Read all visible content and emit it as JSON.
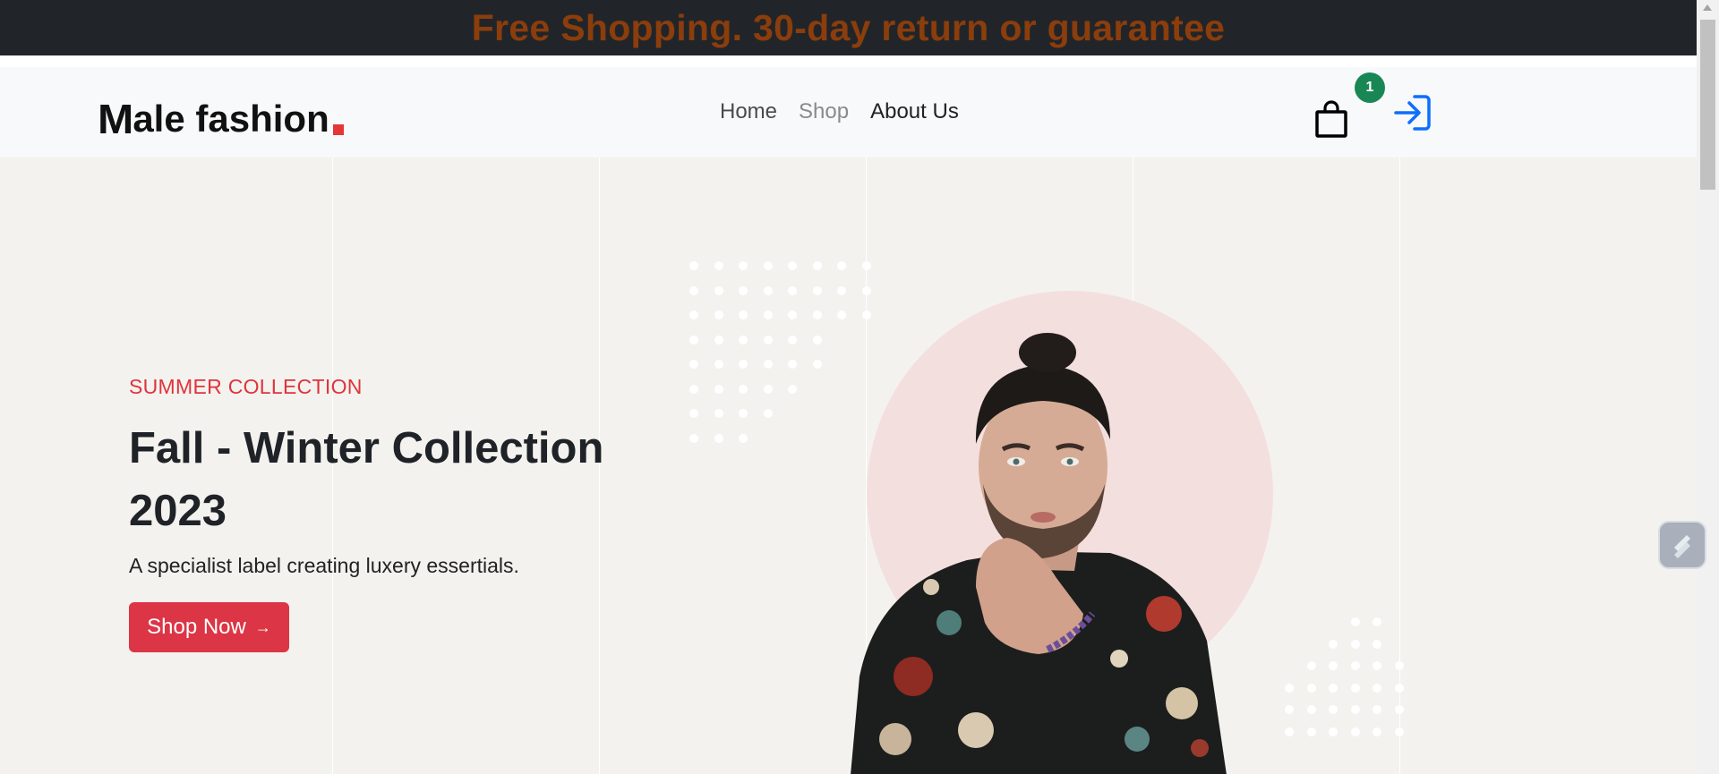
{
  "promo": {
    "text": "Free Shopping. 30-day return or guarantee"
  },
  "navbar": {
    "logo": {
      "first_letter": "M",
      "rest": "ale fashion",
      "accent_color": "#e53637"
    },
    "links": [
      {
        "label": "Home"
      },
      {
        "label": "Shop"
      },
      {
        "label": "About Us"
      }
    ],
    "cart": {
      "icon": "shopping-bag-icon",
      "badge_count": "1",
      "badge_color": "#198754"
    },
    "login": {
      "icon": "login-icon",
      "color": "#0d6efd"
    }
  },
  "hero": {
    "subtitle": "SUMMER COLLECTION",
    "title": "Fall - Winter Collection 2023",
    "tagline": "A specialist label creating luxery essertials.",
    "button": {
      "label": "Shop Now",
      "icon": "arrow-right-icon",
      "color": "#dc3545"
    },
    "image": {
      "icon": "model-portrait-image"
    }
  },
  "widget": {
    "icon": "assistant-widget-icon"
  }
}
